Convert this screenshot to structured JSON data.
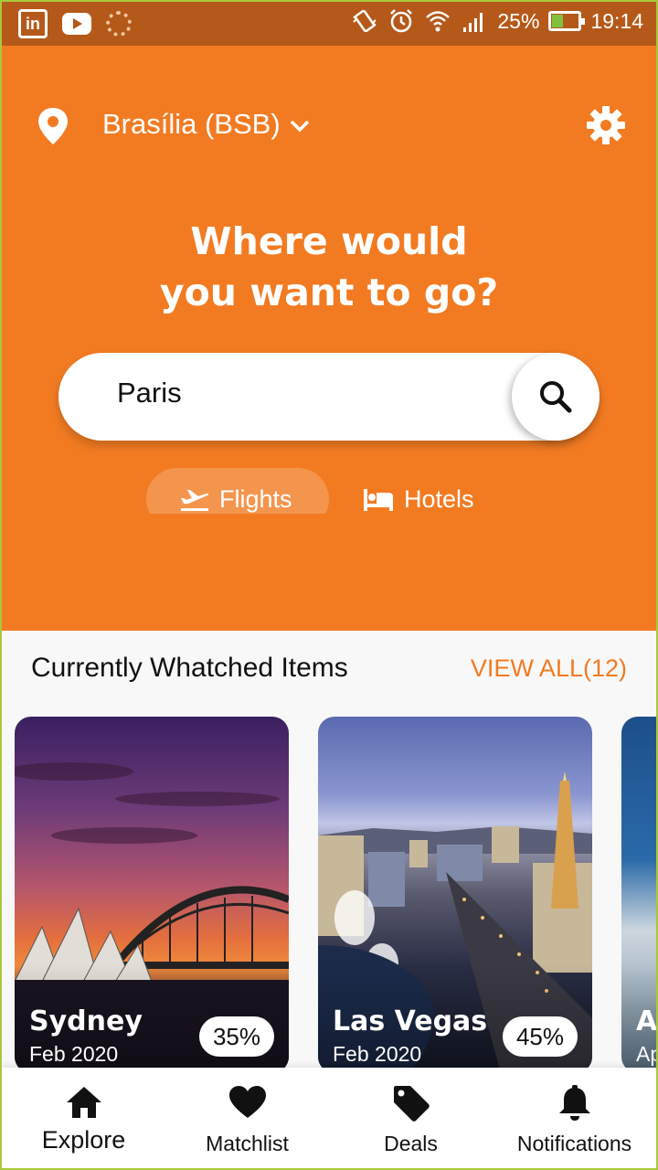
{
  "status_bar": {
    "battery": "25%",
    "time": "19:14",
    "left_icons": [
      "linkedin-icon",
      "youtube-icon",
      "app-icon"
    ],
    "right_icons": [
      "vibrate-icon",
      "alarm-icon",
      "wifi-icon",
      "signal-icon",
      "battery-icon"
    ]
  },
  "header": {
    "location": "Brasília (BSB)",
    "location_icon": "map-pin-icon",
    "settings_icon": "gear-icon"
  },
  "hero": {
    "headline_line1": "Where would",
    "headline_line2": "you want to go?"
  },
  "search": {
    "value": "Paris",
    "button_icon": "search-icon"
  },
  "tabs": [
    {
      "label": "Flights",
      "icon": "airplane-icon",
      "selected": true
    },
    {
      "label": "Hotels",
      "icon": "bed-icon",
      "selected": false
    }
  ],
  "watched": {
    "title": "Currently Whatched Items",
    "view_all": "VIEW ALL(12)",
    "items": [
      {
        "name": "Sydney",
        "date": "Feb 2020",
        "discount": "35%"
      },
      {
        "name": "Las Vegas",
        "date": "Feb 2020",
        "discount": "45%"
      },
      {
        "name": "A",
        "date": "Ap",
        "discount": ""
      }
    ]
  },
  "bottom_nav": [
    {
      "label": "Explore",
      "icon": "home-icon",
      "active": true
    },
    {
      "label": "Matchlist",
      "icon": "heart-icon",
      "active": false
    },
    {
      "label": "Deals",
      "icon": "tag-icon",
      "active": false
    },
    {
      "label": "Notifications",
      "icon": "bell-icon",
      "active": false
    }
  ],
  "colors": {
    "accent": "#f27b22",
    "status_bar": "#b5591a",
    "background": "#f8f8f8"
  }
}
